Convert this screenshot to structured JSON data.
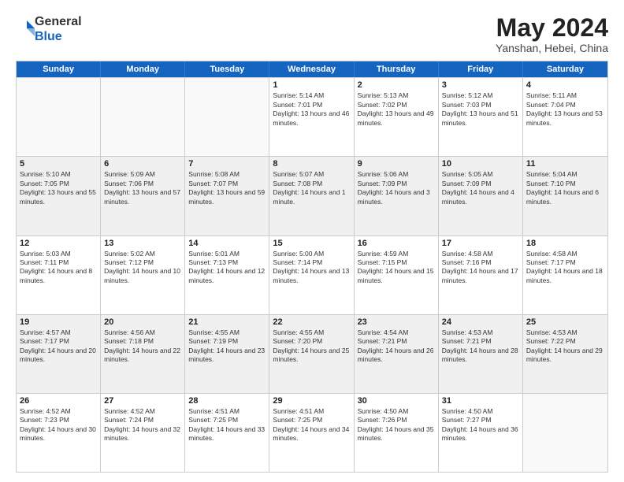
{
  "header": {
    "logo_general": "General",
    "logo_blue": "Blue",
    "month_title": "May 2024",
    "location": "Yanshan, Hebei, China"
  },
  "weekdays": [
    "Sunday",
    "Monday",
    "Tuesday",
    "Wednesday",
    "Thursday",
    "Friday",
    "Saturday"
  ],
  "rows": [
    [
      {
        "day": "",
        "text": ""
      },
      {
        "day": "",
        "text": ""
      },
      {
        "day": "",
        "text": ""
      },
      {
        "day": "1",
        "text": "Sunrise: 5:14 AM\nSunset: 7:01 PM\nDaylight: 13 hours\nand 46 minutes."
      },
      {
        "day": "2",
        "text": "Sunrise: 5:13 AM\nSunset: 7:02 PM\nDaylight: 13 hours\nand 49 minutes."
      },
      {
        "day": "3",
        "text": "Sunrise: 5:12 AM\nSunset: 7:03 PM\nDaylight: 13 hours\nand 51 minutes."
      },
      {
        "day": "4",
        "text": "Sunrise: 5:11 AM\nSunset: 7:04 PM\nDaylight: 13 hours\nand 53 minutes."
      }
    ],
    [
      {
        "day": "5",
        "text": "Sunrise: 5:10 AM\nSunset: 7:05 PM\nDaylight: 13 hours\nand 55 minutes."
      },
      {
        "day": "6",
        "text": "Sunrise: 5:09 AM\nSunset: 7:06 PM\nDaylight: 13 hours\nand 57 minutes."
      },
      {
        "day": "7",
        "text": "Sunrise: 5:08 AM\nSunset: 7:07 PM\nDaylight: 13 hours\nand 59 minutes."
      },
      {
        "day": "8",
        "text": "Sunrise: 5:07 AM\nSunset: 7:08 PM\nDaylight: 14 hours\nand 1 minute."
      },
      {
        "day": "9",
        "text": "Sunrise: 5:06 AM\nSunset: 7:09 PM\nDaylight: 14 hours\nand 3 minutes."
      },
      {
        "day": "10",
        "text": "Sunrise: 5:05 AM\nSunset: 7:09 PM\nDaylight: 14 hours\nand 4 minutes."
      },
      {
        "day": "11",
        "text": "Sunrise: 5:04 AM\nSunset: 7:10 PM\nDaylight: 14 hours\nand 6 minutes."
      }
    ],
    [
      {
        "day": "12",
        "text": "Sunrise: 5:03 AM\nSunset: 7:11 PM\nDaylight: 14 hours\nand 8 minutes."
      },
      {
        "day": "13",
        "text": "Sunrise: 5:02 AM\nSunset: 7:12 PM\nDaylight: 14 hours\nand 10 minutes."
      },
      {
        "day": "14",
        "text": "Sunrise: 5:01 AM\nSunset: 7:13 PM\nDaylight: 14 hours\nand 12 minutes."
      },
      {
        "day": "15",
        "text": "Sunrise: 5:00 AM\nSunset: 7:14 PM\nDaylight: 14 hours\nand 13 minutes."
      },
      {
        "day": "16",
        "text": "Sunrise: 4:59 AM\nSunset: 7:15 PM\nDaylight: 14 hours\nand 15 minutes."
      },
      {
        "day": "17",
        "text": "Sunrise: 4:58 AM\nSunset: 7:16 PM\nDaylight: 14 hours\nand 17 minutes."
      },
      {
        "day": "18",
        "text": "Sunrise: 4:58 AM\nSunset: 7:17 PM\nDaylight: 14 hours\nand 18 minutes."
      }
    ],
    [
      {
        "day": "19",
        "text": "Sunrise: 4:57 AM\nSunset: 7:17 PM\nDaylight: 14 hours\nand 20 minutes."
      },
      {
        "day": "20",
        "text": "Sunrise: 4:56 AM\nSunset: 7:18 PM\nDaylight: 14 hours\nand 22 minutes."
      },
      {
        "day": "21",
        "text": "Sunrise: 4:55 AM\nSunset: 7:19 PM\nDaylight: 14 hours\nand 23 minutes."
      },
      {
        "day": "22",
        "text": "Sunrise: 4:55 AM\nSunset: 7:20 PM\nDaylight: 14 hours\nand 25 minutes."
      },
      {
        "day": "23",
        "text": "Sunrise: 4:54 AM\nSunset: 7:21 PM\nDaylight: 14 hours\nand 26 minutes."
      },
      {
        "day": "24",
        "text": "Sunrise: 4:53 AM\nSunset: 7:21 PM\nDaylight: 14 hours\nand 28 minutes."
      },
      {
        "day": "25",
        "text": "Sunrise: 4:53 AM\nSunset: 7:22 PM\nDaylight: 14 hours\nand 29 minutes."
      }
    ],
    [
      {
        "day": "26",
        "text": "Sunrise: 4:52 AM\nSunset: 7:23 PM\nDaylight: 14 hours\nand 30 minutes."
      },
      {
        "day": "27",
        "text": "Sunrise: 4:52 AM\nSunset: 7:24 PM\nDaylight: 14 hours\nand 32 minutes."
      },
      {
        "day": "28",
        "text": "Sunrise: 4:51 AM\nSunset: 7:25 PM\nDaylight: 14 hours\nand 33 minutes."
      },
      {
        "day": "29",
        "text": "Sunrise: 4:51 AM\nSunset: 7:25 PM\nDaylight: 14 hours\nand 34 minutes."
      },
      {
        "day": "30",
        "text": "Sunrise: 4:50 AM\nSunset: 7:26 PM\nDaylight: 14 hours\nand 35 minutes."
      },
      {
        "day": "31",
        "text": "Sunrise: 4:50 AM\nSunset: 7:27 PM\nDaylight: 14 hours\nand 36 minutes."
      },
      {
        "day": "",
        "text": ""
      }
    ]
  ]
}
